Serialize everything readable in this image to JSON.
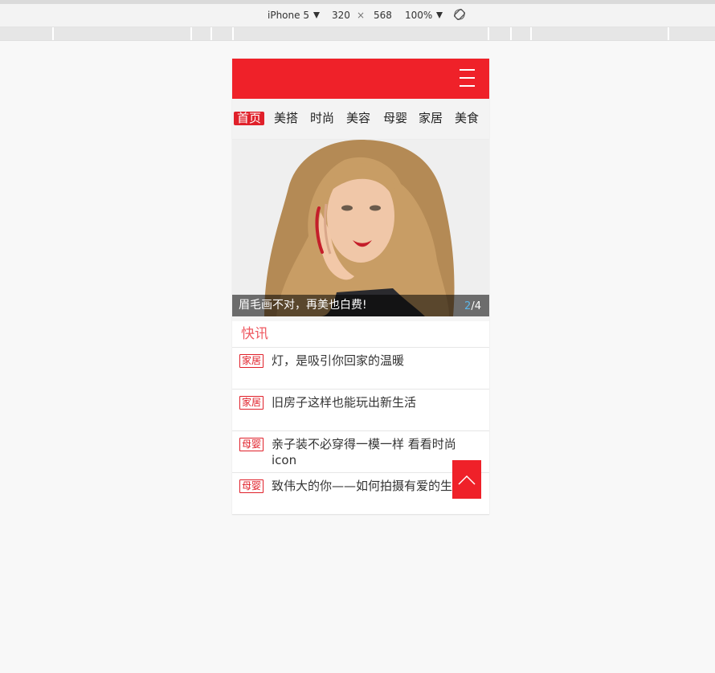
{
  "devtools": {
    "device": "iPhone 5",
    "width": "320",
    "times": "×",
    "height": "568",
    "zoom": "100%"
  },
  "header": {
    "menu_icon": "hamburger-menu-icon"
  },
  "nav": {
    "items": [
      "首页",
      "美搭",
      "时尚",
      "美容",
      "母婴",
      "家居",
      "美食"
    ],
    "active_index": 0
  },
  "banner": {
    "caption": "眉毛画不对，再美也白费!",
    "current": "2",
    "separator": "/",
    "total": "4"
  },
  "news": {
    "title": "快讯",
    "items": [
      {
        "tag": "家居",
        "title": "灯，是吸引你回家的温暖"
      },
      {
        "tag": "家居",
        "title": "旧房子这样也能玩出新生活"
      },
      {
        "tag": "母婴",
        "title": "亲子装不必穿得一模一样 看看时尚icon"
      },
      {
        "tag": "母婴",
        "title": "致伟大的你——如何拍摄有爱的生活"
      }
    ]
  },
  "colors": {
    "brand_red": "#ef2129",
    "counter_blue": "#5bb5e8"
  }
}
